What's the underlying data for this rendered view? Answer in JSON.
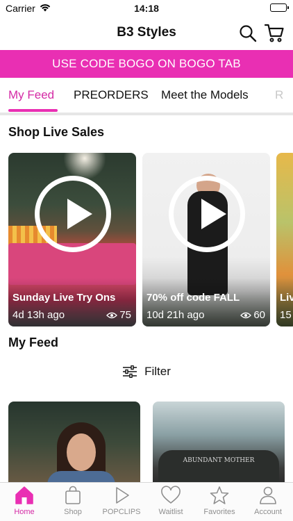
{
  "status_bar": {
    "carrier": "Carrier",
    "time": "14:18"
  },
  "header": {
    "title": "B3 Styles"
  },
  "promo": {
    "text": "USE CODE BOGO ON BOGO TAB"
  },
  "tabs": [
    {
      "label": "My Feed",
      "active": true
    },
    {
      "label": "PREORDERS",
      "active": false
    },
    {
      "label": "Meet the Models",
      "active": false
    },
    {
      "label": "R",
      "active": false
    }
  ],
  "live_sales": {
    "title": "Shop Live Sales",
    "cards": [
      {
        "title": "Sunday Live Try Ons",
        "time_ago": "4d 13h ago",
        "views": "75"
      },
      {
        "title": "70% off code FALL",
        "time_ago": "10d 21h ago",
        "views": "60"
      },
      {
        "title": "Liv",
        "time_ago": "15",
        "views": ""
      }
    ]
  },
  "feed": {
    "title": "My Feed",
    "filter_label": "Filter",
    "posts": [
      {
        "type": "image",
        "caption": ""
      },
      {
        "type": "image",
        "sign_text": "ABUNDANT MOTHER"
      }
    ]
  },
  "bottom_nav": [
    {
      "label": "Home",
      "icon": "home-icon",
      "active": true
    },
    {
      "label": "Shop",
      "icon": "shopping-bag-icon",
      "active": false
    },
    {
      "label": "POPCLIPS",
      "icon": "play-icon",
      "active": false
    },
    {
      "label": "Waitlist",
      "icon": "heart-icon",
      "active": false
    },
    {
      "label": "Favorites",
      "icon": "star-icon",
      "active": false
    },
    {
      "label": "Account",
      "icon": "person-icon",
      "active": false
    }
  ],
  "colors": {
    "accent": "#e92fb3",
    "active_tab_text": "#d42aa5",
    "inactive_icon": "#8e8e8e"
  }
}
